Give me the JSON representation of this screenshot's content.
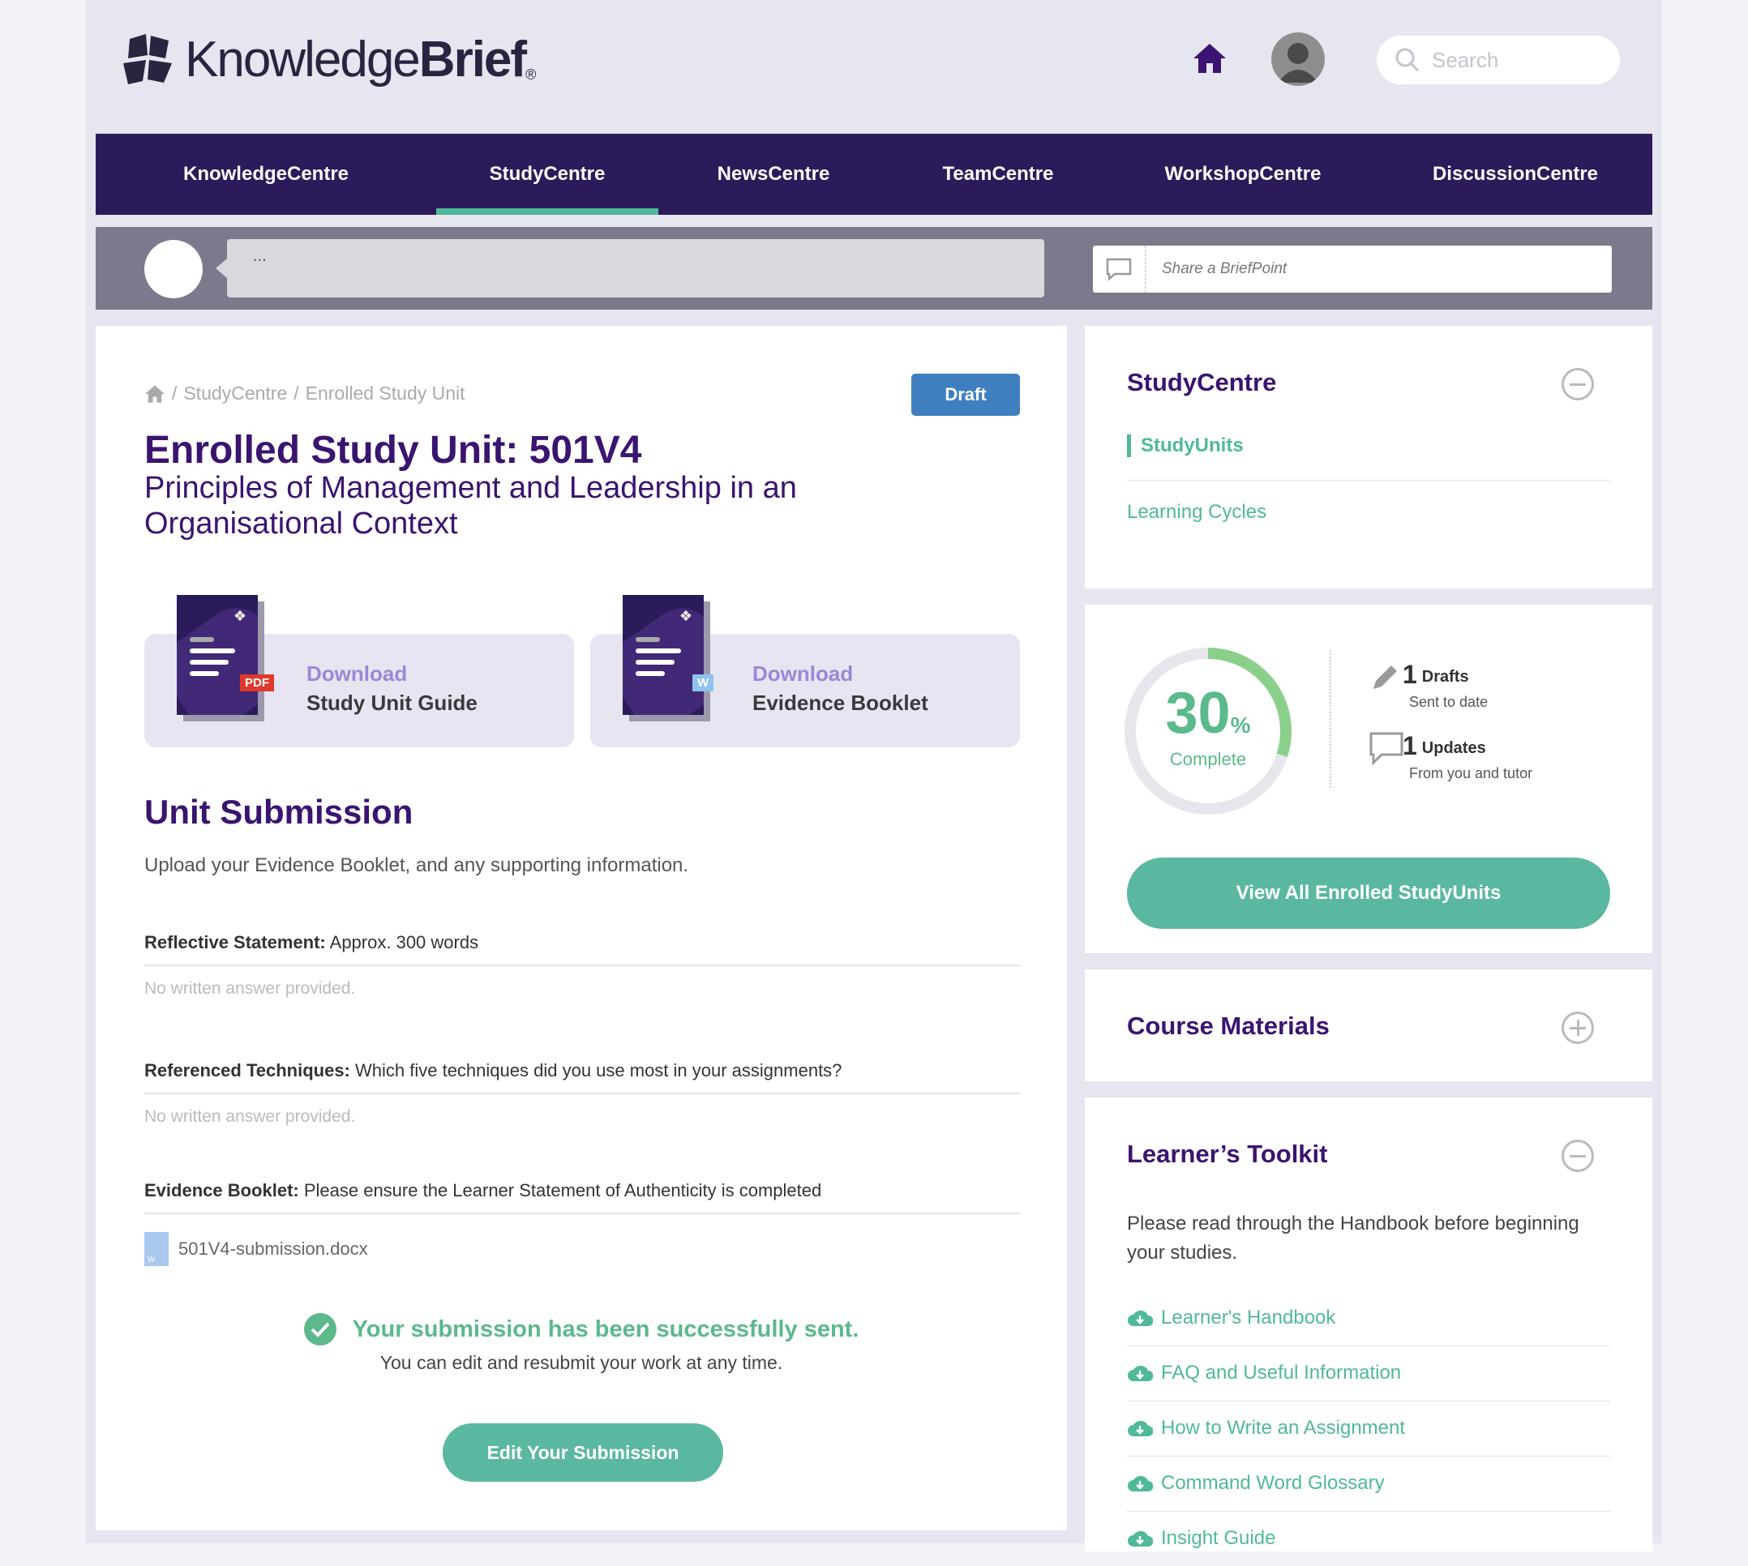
{
  "header": {
    "logo": {
      "light": "Knowledge",
      "bold": "Brief",
      "reg": "®"
    },
    "search_placeholder": "Search"
  },
  "nav": {
    "items": [
      {
        "label": "KnowledgeCentre",
        "active": false
      },
      {
        "label": "StudyCentre",
        "active": true
      },
      {
        "label": "NewsCentre",
        "active": false
      },
      {
        "label": "TeamCentre",
        "active": false
      },
      {
        "label": "WorkshopCentre",
        "active": false
      },
      {
        "label": "DiscussionCentre",
        "active": false
      }
    ]
  },
  "briefpoint": {
    "bubble_text": "...",
    "share_placeholder": "Share a BriefPoint"
  },
  "main": {
    "breadcrumb": {
      "sep": "/",
      "items": [
        "StudyCentre",
        "Enrolled Study Unit"
      ]
    },
    "status_badge": "Draft",
    "title": "Enrolled Study Unit: 501V4",
    "subtitle": "Principles of Management and Leadership in an Organisational Context",
    "downloads": [
      {
        "action": "Download",
        "name": "Study Unit Guide",
        "badge": "PDF",
        "badge_color": "#e0392b"
      },
      {
        "action": "Download",
        "name": "Evidence Booklet",
        "badge": "W",
        "badge_color": "#8ec3ef"
      }
    ],
    "section_title": "Unit Submission",
    "section_desc": "Upload your Evidence Booklet, and any supporting information.",
    "questions": [
      {
        "label": "Reflective Statement:",
        "text": " Approx. 300 words",
        "answer": "No written answer provided."
      },
      {
        "label": "Referenced Techniques:",
        "text": " Which five techniques did you use most in your assignments?",
        "answer": "No written answer provided."
      },
      {
        "label": "Evidence Booklet:",
        "text": " Please ensure the Learner Statement of Authenticity is completed",
        "answer": ""
      }
    ],
    "file_name": "501V4-submission.docx",
    "success_title": "Your submission has been successfully sent.",
    "success_sub": "You can edit and resubmit your work at any time.",
    "edit_button": "Edit Your Submission"
  },
  "sidebar": {
    "studycentre": {
      "title": "StudyCentre",
      "links": [
        {
          "label": "StudyUnits",
          "active": true
        },
        {
          "label": "Learning Cycles",
          "active": false
        }
      ]
    },
    "progress": {
      "percent": 30,
      "percent_symbol": "%",
      "label": "Complete",
      "drafts": {
        "value": "1",
        "label": "Drafts",
        "desc": "Sent to date"
      },
      "updates": {
        "value": "1",
        "label": "Updates",
        "desc": "From you and tutor"
      },
      "button": "View All Enrolled StudyUnits"
    },
    "course_materials": {
      "title": "Course Materials"
    },
    "toolkit": {
      "title": "Learner’s Toolkit",
      "desc": "Please read through the Handbook before beginning your studies.",
      "links": [
        "Learner's Handbook",
        "FAQ and Useful Information",
        "How to Write an Assignment",
        "Command Word Glossary",
        "Insight Guide"
      ]
    }
  },
  "colors": {
    "brand": "#2b1b5a",
    "heading": "#3a1470",
    "accent": "#4fb99a",
    "button": "#5bb8a0",
    "draft": "#3f7fc0"
  },
  "icons": [
    "logo-icon",
    "home-icon",
    "avatar-icon",
    "search-icon",
    "comment-icon",
    "pencil-icon",
    "chat-icon",
    "check-icon",
    "minus-icon",
    "plus-icon",
    "cloud-download-icon",
    "document-icon"
  ]
}
